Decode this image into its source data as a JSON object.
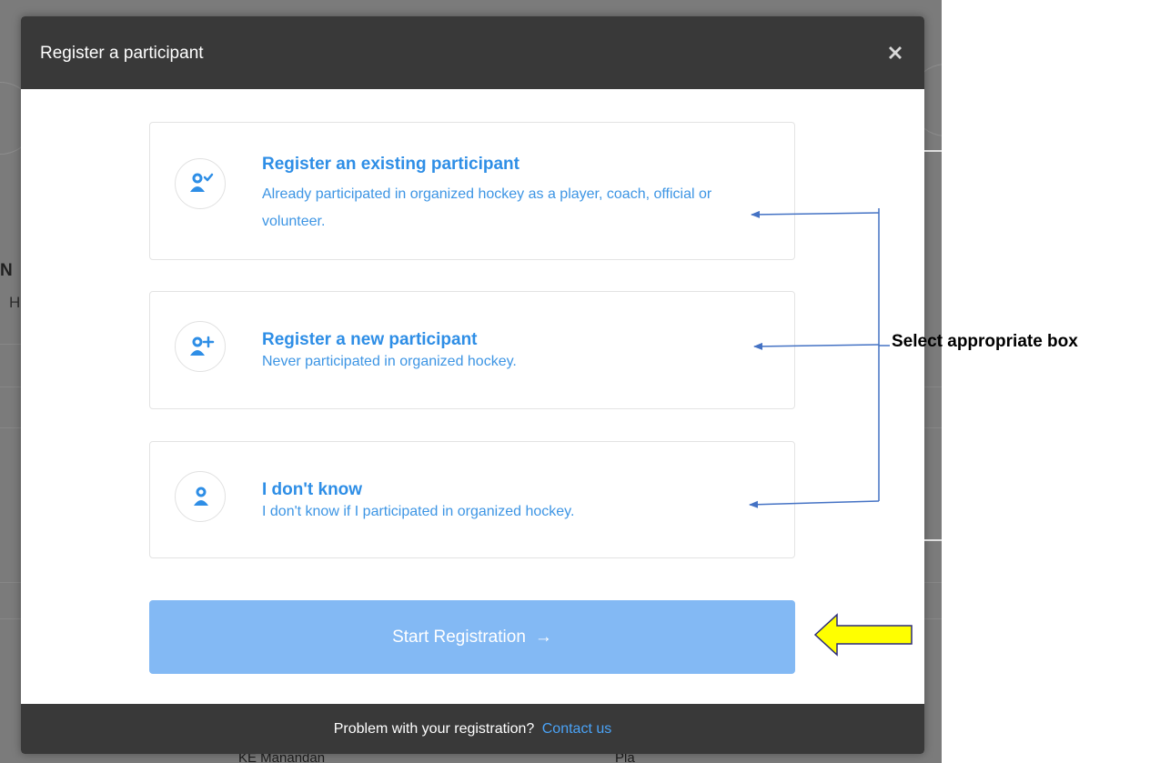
{
  "backdrop": {
    "left_glyph_1": "N",
    "left_glyph_2": "H",
    "bottom_text_1": "KE Manandan",
    "bottom_text_2": "Pla"
  },
  "modal": {
    "title": "Register a participant",
    "close_icon": "close-icon"
  },
  "options": [
    {
      "icon": "user-check-icon",
      "title": "Register an existing participant",
      "description": "Already participated in organized hockey as a player, coach, official or volunteer."
    },
    {
      "icon": "user-plus-icon",
      "title": "Register a new participant",
      "description": "Never participated in organized hockey."
    },
    {
      "icon": "user-icon",
      "title": "I don't know",
      "description": "I don't know if I participated in organized hockey."
    }
  ],
  "start_button": {
    "label": "Start Registration",
    "arrow": "→"
  },
  "footer": {
    "text": "Problem with your registration?",
    "link": "Contact us"
  },
  "annotation": {
    "label": "Select appropriate box"
  },
  "colors": {
    "header_bg": "#393939",
    "accent_blue": "#2e8ee6",
    "button_blue": "#83b9f4",
    "link_blue": "#4aa3f7",
    "arrow_blue": "#4472c4",
    "highlight_yellow": "#ffff00"
  }
}
